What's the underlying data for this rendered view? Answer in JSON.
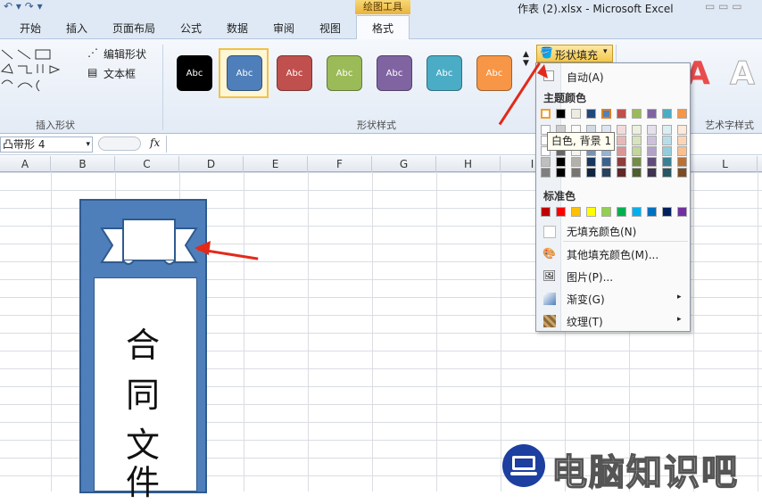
{
  "window": {
    "title": "作表 (2).xlsx - Microsoft Excel",
    "context_tab": "绘图工具"
  },
  "tabs": [
    "开始",
    "插入",
    "页面布局",
    "公式",
    "数据",
    "审阅",
    "视图",
    "格式"
  ],
  "ribbon": {
    "edit_shape": "编辑形状",
    "text_box": "文本框",
    "group_insert_shapes": "插入形状",
    "group_shape_styles": "形状样式",
    "group_wordart": "艺术字样式",
    "style_label": "Abc",
    "style_colors": [
      "#000000",
      "#4f7fba",
      "#c0504d",
      "#9bbb59",
      "#8064a2",
      "#4bacc6",
      "#f79646"
    ],
    "shape_fill": "形状填充"
  },
  "formula": {
    "name_box": "凸带形 4",
    "fx": "fx"
  },
  "columns": [
    "A",
    "B",
    "C",
    "D",
    "E",
    "F",
    "G",
    "H",
    "I",
    "L"
  ],
  "banner_text": [
    "合",
    "同",
    "文",
    "件"
  ],
  "menu": {
    "auto": "自动(A)",
    "theme_colors_header": "主题颜色",
    "theme_top": [
      "#ffffff",
      "#000000",
      "#eeece1",
      "#1f497d",
      "#4f81bd",
      "#c0504d",
      "#9bbb59",
      "#8064a2",
      "#4bacc6",
      "#f79646"
    ],
    "standard_header": "标准色",
    "standard": [
      "#c00000",
      "#ff0000",
      "#ffc000",
      "#ffff00",
      "#92d050",
      "#00b050",
      "#00b0f0",
      "#0070c0",
      "#002060",
      "#7030a0"
    ],
    "no_fill": "无填充颜色(N)",
    "more_colors": "其他填充颜色(M)...",
    "picture": "图片(P)...",
    "gradient": "渐变(G)",
    "texture": "纹理(T)"
  },
  "tooltip": "白色, 背景 1",
  "watermark": "电脑知识吧"
}
